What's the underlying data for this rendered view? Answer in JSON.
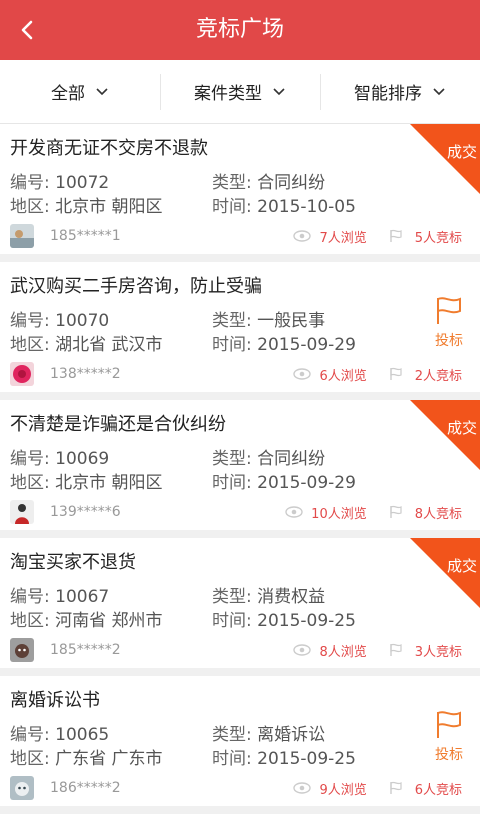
{
  "header": {
    "title": "竞标广场"
  },
  "filters": [
    {
      "label": "全部"
    },
    {
      "label": "案件类型"
    },
    {
      "label": "智能排序"
    }
  ],
  "field_labels": {
    "id": "编号:",
    "type": "类型:",
    "region": "地区:",
    "time": "时间:"
  },
  "colors": {
    "brand": "#e14848",
    "ribbon": "#f2541b",
    "bid": "#f07c2e"
  },
  "cases": [
    {
      "title": "开发商无证不交房不退款",
      "id": "10072",
      "type": "合同纠纷",
      "region": "北京市 朝阳区",
      "time": "2015-10-05",
      "phone": "185*****1",
      "views": "7人浏览",
      "bids": "5人竞标",
      "badge": "成交",
      "avatar_icon": "avatar-landscape"
    },
    {
      "title": "武汉购买二手房咨询，防止受骗",
      "id": "10070",
      "type": "一般民事",
      "region": "湖北省 武汉市",
      "time": "2015-09-29",
      "phone": "138*****2",
      "views": "6人浏览",
      "bids": "2人竞标",
      "action": "投标",
      "avatar_icon": "avatar-rose"
    },
    {
      "title": "不清楚是诈骗还是合伙纠纷",
      "id": "10069",
      "type": "合同纠纷",
      "region": "北京市 朝阳区",
      "time": "2015-09-29",
      "phone": "139*****6",
      "views": "10人浏览",
      "bids": "8人竞标",
      "badge": "成交",
      "avatar_icon": "avatar-person"
    },
    {
      "title": "淘宝买家不退货",
      "id": "10067",
      "type": "消费权益",
      "region": "河南省 郑州市",
      "time": "2015-09-25",
      "phone": "185*****2",
      "views": "8人浏览",
      "bids": "3人竞标",
      "badge": "成交",
      "avatar_icon": "avatar-pet"
    },
    {
      "title": "离婚诉讼书",
      "id": "10065",
      "type": "离婚诉讼",
      "region": "广东省 广东市",
      "time": "2015-09-25",
      "phone": "186*****2",
      "views": "9人浏览",
      "bids": "6人竞标",
      "action": "投标",
      "avatar_icon": "avatar-pet"
    }
  ]
}
